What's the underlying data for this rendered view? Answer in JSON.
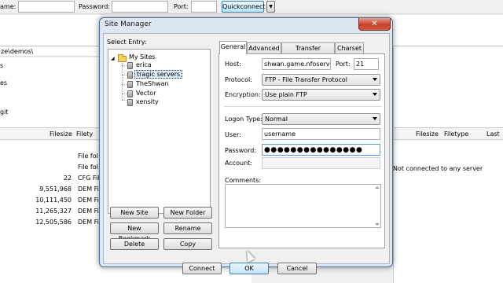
{
  "quickconnect": {
    "host_label_fragment": "ame:",
    "password_label": "Password:",
    "port_label": "Port:",
    "button_label": "Quickconnect",
    "dropdown_arrow": "▼"
  },
  "local": {
    "path_fragment": "ze\\demos\\",
    "tree_fragments": [
      "s",
      "es",
      "",
      "git"
    ],
    "header": {
      "filesize": "Filesize",
      "filetype": "Filety"
    },
    "files": [
      {
        "size": "",
        "type": "File fol"
      },
      {
        "size": "",
        "type": "File fol"
      },
      {
        "size": "22",
        "type": "CFG Fil"
      },
      {
        "size": "9,551,968",
        "type": "DEM Fi"
      },
      {
        "size": "10,111,450",
        "type": "DEM Fi"
      },
      {
        "size": "11,265,327",
        "type": "DEM Fi"
      },
      {
        "size": "12,505,586",
        "type": "DEM Fi"
      }
    ]
  },
  "remote": {
    "header": {
      "filesize": "Filesize",
      "filetype": "Filetype",
      "lastmod": "Last m"
    },
    "status": "Not connected to any server"
  },
  "dialog": {
    "title": "Site Manager",
    "close": "✕",
    "select_entry_label": "Select Entry:",
    "tree": {
      "root": "My Sites",
      "sites": [
        "erica",
        "tragic servers",
        "TheShwan",
        "Vector",
        "xensity"
      ],
      "selected": "tragic servers"
    },
    "buttons": {
      "new_site": "New Site",
      "new_folder": "New Folder",
      "new_bookmark": "New Bookmark",
      "rename": "Rename",
      "delete": "Delete",
      "copy": "Copy",
      "connect": "Connect",
      "ok": "OK",
      "cancel": "Cancel"
    },
    "tabs": [
      "General",
      "Advanced",
      "Transfer Settings",
      "Charset"
    ],
    "active_tab": "General",
    "general": {
      "host_label": "Host:",
      "host_value": "shwan.game.nfoservers.",
      "port_label": "Port:",
      "port_value": "21",
      "protocol_label": "Protocol:",
      "protocol_value": "FTP - File Transfer Protocol",
      "encryption_label": "Encryption:",
      "encryption_value": "Use plain FTP",
      "logon_label": "Logon Type:",
      "logon_value": "Normal",
      "user_label": "User:",
      "user_value": "username",
      "password_label": "Password:",
      "password_value": "●●●●●●●●●●●●●●●",
      "account_label": "Account:",
      "account_value": "",
      "comments_label": "Comments:"
    }
  }
}
